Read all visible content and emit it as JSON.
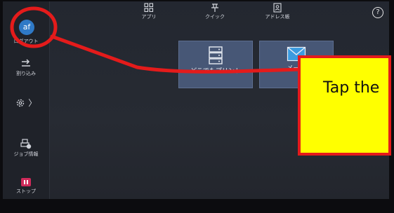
{
  "sidebar": {
    "avatar_text": "af",
    "avatar_caption": "ログアウト",
    "interrupt_label": "割り込み",
    "job_info_label": "ジョブ情報",
    "stop_label": "ストップ",
    "settings_chevron": "〉"
  },
  "topbar": {
    "apps_label": "アプリ",
    "quick_label": "クイック",
    "address_label": "アドレス帳",
    "help_symbol": "?"
  },
  "tiles": [
    {
      "label": "どこでもプリント",
      "icon": "server-stack-icon"
    },
    {
      "label": "メール",
      "icon": "envelope-icon"
    }
  ],
  "callout": {
    "text": "Tap the"
  },
  "colors": {
    "annotation_red": "#e41b1b",
    "callout_yellow": "#ffff00",
    "tile_blue": "#475776",
    "avatar_blue": "#2f79c6"
  }
}
